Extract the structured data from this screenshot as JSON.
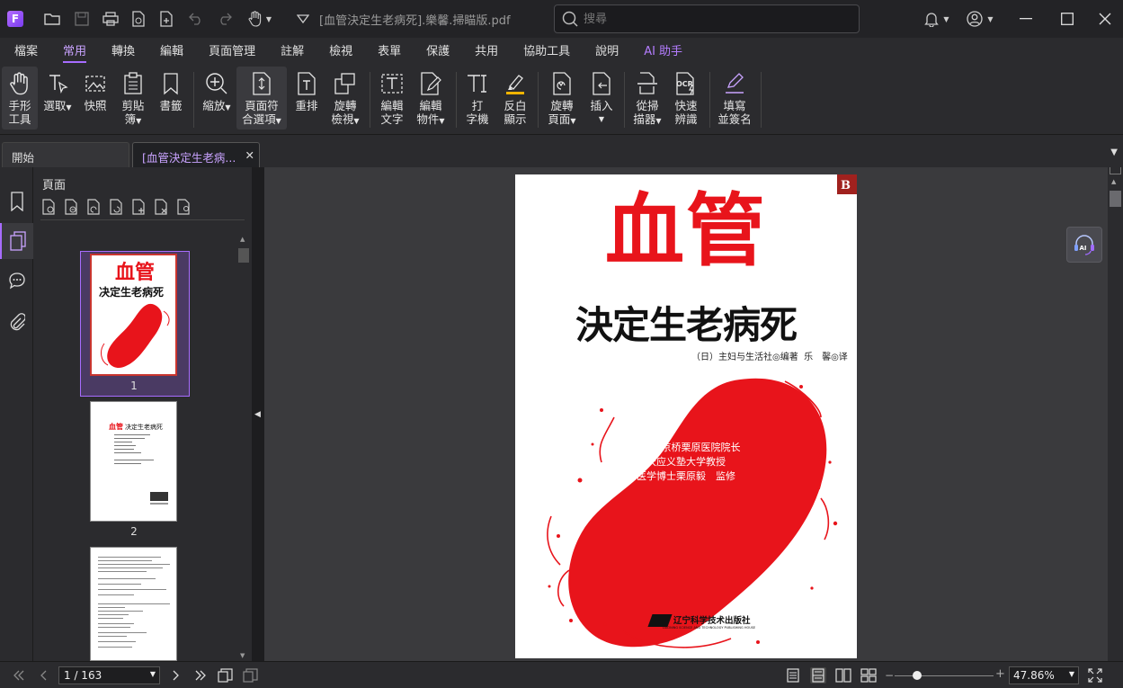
{
  "titlebar": {
    "doc_title": "[血管決定生老病死].樂馨.掃瞄版.pdf",
    "search_placeholder": "搜尋"
  },
  "menu": [
    "檔案",
    "常用",
    "轉換",
    "編輯",
    "頁面管理",
    "註解",
    "檢視",
    "表單",
    "保護",
    "共用",
    "協助工具",
    "說明",
    "AI 助手"
  ],
  "menu_active": "常用",
  "ribbon": {
    "hand": [
      "手形",
      "工具"
    ],
    "select": [
      "選取",
      ""
    ],
    "snapshot": [
      "快照",
      ""
    ],
    "clipboard": [
      "剪貼",
      "簿"
    ],
    "bookmark": [
      "書籤",
      ""
    ],
    "zoom": [
      "縮放",
      ""
    ],
    "fit": [
      "頁面符",
      "合選項"
    ],
    "reflow": [
      "重排",
      ""
    ],
    "rotate_view": [
      "旋轉",
      "檢視"
    ],
    "edit_text": [
      "編輯",
      "文字"
    ],
    "edit_object": [
      "編輯",
      "物件"
    ],
    "typewriter": [
      "打",
      "字機"
    ],
    "highlight": [
      "反白",
      "顯示"
    ],
    "rotate_page": [
      "旋轉",
      "頁面"
    ],
    "insert": [
      "插入",
      ""
    ],
    "scanner": [
      "從掃",
      "描器"
    ],
    "ocr": [
      "快速",
      "辨識"
    ],
    "fill_sign": [
      "填寫",
      "並簽名"
    ]
  },
  "tabs": {
    "start": "開始",
    "doc": "[血管決定生老病..."
  },
  "panel": {
    "title": "頁面",
    "thumbs": [
      "1",
      "2",
      ""
    ]
  },
  "cover": {
    "title_big": "血管",
    "title_sub": "決定生老病死",
    "authors": "（日）主妇与生活社◎编著  乐　馨◎译",
    "line1": "日本东京桥栗原医院院长",
    "line2": "庆应义塾大学教授",
    "line3": "医学博士栗原毅　监修",
    "publisher": "辽宁科学技术出版社",
    "publisher_en": "LIAONING SCIENCE AND TECHNOLOGY PUBLISHING HOUSE"
  },
  "status": {
    "page_display": "1 / 163",
    "zoom": "47.86%"
  },
  "colors": {
    "accent": "#a76cff",
    "cover_red": "#e8141b"
  }
}
